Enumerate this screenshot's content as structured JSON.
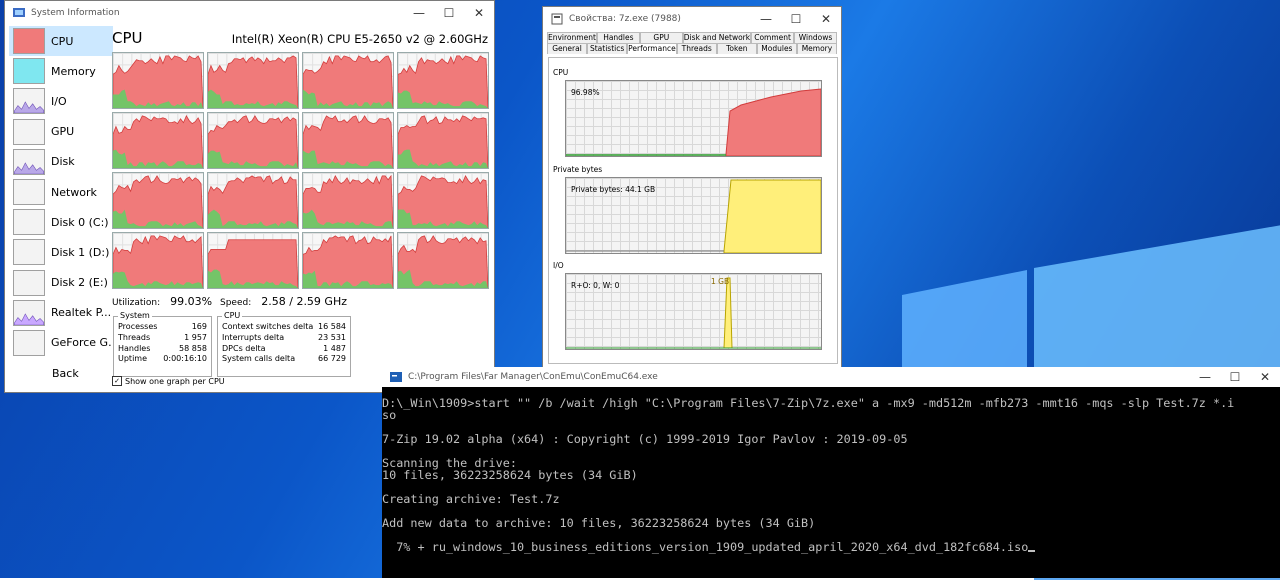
{
  "colors": {
    "cpu_fill": "#f07a7a",
    "cpu_line": "#d23c3c",
    "kernel": "#66cc66",
    "yellow": "#ffef7a",
    "accent": "#cce8ff"
  },
  "taskmgr": {
    "title": "System Information",
    "sidebar": [
      {
        "label": "CPU",
        "icon": "cpu-graph-icon"
      },
      {
        "label": "Memory",
        "icon": "memory-graph-icon"
      },
      {
        "label": "I/O",
        "icon": "io-graph-icon"
      },
      {
        "label": "GPU",
        "icon": "gpu-graph-icon"
      },
      {
        "label": "Disk",
        "icon": "disk-graph-icon"
      },
      {
        "label": "Network",
        "icon": "network-graph-icon"
      },
      {
        "label": "Disk 0 (C:)",
        "icon": "disk-graph-icon"
      },
      {
        "label": "Disk 1 (D:)",
        "icon": "disk-graph-icon"
      },
      {
        "label": "Disk 2 (E:)",
        "icon": "disk-graph-icon"
      },
      {
        "label": "Realtek P...",
        "icon": "network-graph-icon"
      },
      {
        "label": "GeForce G...",
        "icon": "gpu-graph-icon"
      }
    ],
    "back_label": "Back",
    "heading": "CPU",
    "cpu_model": "Intel(R) Xeon(R) CPU E5-2650 v2 @ 2.60GHz",
    "utilization_label": "Utilization:",
    "utilization_value": "99.03%",
    "speed_label": "Speed:",
    "speed_value": "2.58 / 2.59 GHz",
    "system_box": {
      "title": "System",
      "rows": [
        {
          "k": "Processes",
          "v": "169"
        },
        {
          "k": "Threads",
          "v": "1 957"
        },
        {
          "k": "Handles",
          "v": "58 858"
        },
        {
          "k": "Uptime",
          "v": "0:00:16:10"
        }
      ]
    },
    "cpu_box": {
      "title": "CPU",
      "rows": [
        {
          "k": "Context switches delta",
          "v": "16 584"
        },
        {
          "k": "Interrupts delta",
          "v": "23 531"
        },
        {
          "k": "DPCs delta",
          "v": "1 487"
        },
        {
          "k": "System calls delta",
          "v": "66 729"
        }
      ]
    },
    "checkbox_label": "Show one graph per CPU",
    "checkbox_checked": true
  },
  "props": {
    "title": "Свойства: 7z.exe (7988)",
    "tabs_row1": [
      "Environment",
      "Handles",
      "GPU",
      "Disk and Network",
      "Comment",
      "Windows"
    ],
    "tabs_row2": [
      "General",
      "Statistics",
      "Performance",
      "Threads",
      "Token",
      "Modules",
      "Memory"
    ],
    "selected_tab": "Performance",
    "cpu_label": "CPU",
    "cpu_value": "96.98%",
    "private_label": "Private bytes",
    "private_value": "Private bytes: 44.1 GB",
    "io_label": "I/O",
    "io_value": "R+O: 0, W: 0",
    "io_peak": "1 GB"
  },
  "console": {
    "title": "C:\\Program Files\\Far Manager\\ConEmu\\ConEmuC64.exe",
    "lines": [
      "D:\\_Win\\1909>start \"\" /b /wait /high \"C:\\Program Files\\7-Zip\\7z.exe\" a -mx9 -md512m -mfb273 -mmt16 -mqs -slp Test.7z *.i",
      "so",
      "",
      "7-Zip 19.02 alpha (x64) : Copyright (c) 1999-2019 Igor Pavlov : 2019-09-05",
      "",
      "Scanning the drive:",
      "10 files, 36223258624 bytes (34 GiB)",
      "",
      "Creating archive: Test.7z",
      "",
      "Add new data to archive: 10 files, 36223258624 bytes (34 GiB)",
      "",
      "  7% + ru_windows_10_business_editions_version_1909_updated_april_2020_x64_dvd_182fc684.iso"
    ]
  }
}
